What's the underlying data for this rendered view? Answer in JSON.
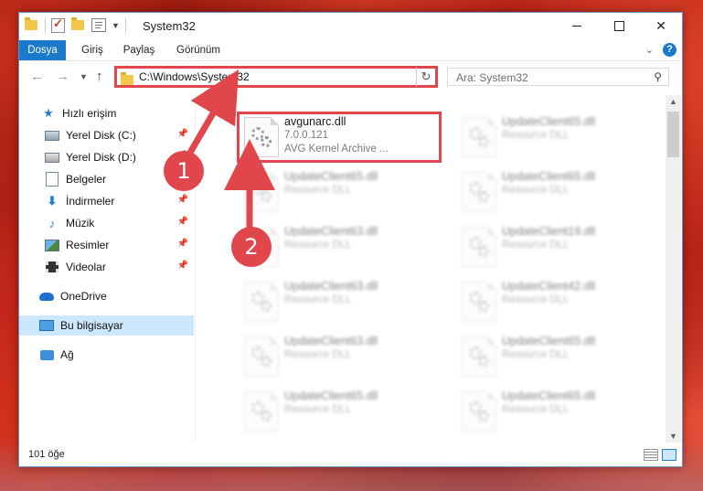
{
  "window": {
    "title": "System32"
  },
  "ribbon": {
    "tabs": [
      "Dosya",
      "Giriş",
      "Paylaş",
      "Görünüm"
    ]
  },
  "address": {
    "path": "C:\\Windows\\System32"
  },
  "search": {
    "placeholder": "Ara: System32"
  },
  "sidebar": {
    "items": [
      {
        "label": "Hızlı erişim",
        "icon": "star-icon"
      },
      {
        "label": "Yerel Disk (C:)",
        "icon": "drive-icon",
        "pinned": true
      },
      {
        "label": "Yerel Disk (D:)",
        "icon": "drive-icon",
        "pinned": true
      },
      {
        "label": "Belgeler",
        "icon": "documents-icon",
        "pinned": true
      },
      {
        "label": "İndirmeler",
        "icon": "download-icon",
        "pinned": true
      },
      {
        "label": "Müzik",
        "icon": "music-icon",
        "pinned": true
      },
      {
        "label": "Resimler",
        "icon": "pictures-icon",
        "pinned": true
      },
      {
        "label": "Videolar",
        "icon": "videos-icon",
        "pinned": true
      },
      {
        "label": "OneDrive",
        "icon": "onedrive-icon"
      },
      {
        "label": "Bu bilgisayar",
        "icon": "computer-icon",
        "selected": true
      },
      {
        "label": "Ağ",
        "icon": "network-icon"
      }
    ]
  },
  "files": {
    "highlighted": {
      "name": "avgunarc.dll",
      "version": "7.0.0.121",
      "desc": "AVG Kernel Archive ..."
    },
    "col1": [
      {
        "name": "UpdateClient65.dll",
        "desc": "Resource DLL"
      },
      {
        "name": "UpdateClient63.dll",
        "desc": "Resource DLL"
      },
      {
        "name": "UpdateClient63.dll",
        "desc": "Resource DLL"
      },
      {
        "name": "UpdateClient63.dll",
        "desc": "Resource DLL"
      },
      {
        "name": "UpdateClient65.dll",
        "desc": "Resource DLL"
      }
    ],
    "col2": [
      {
        "name": "UpdateClient65.dll",
        "desc": "Resource DLL"
      },
      {
        "name": "UpdateClient65.dll",
        "desc": "Resource DLL"
      },
      {
        "name": "UpdateClient19.dll",
        "desc": "Resource DLL"
      },
      {
        "name": "UpdateClient42.dll",
        "desc": "Resource DLL"
      },
      {
        "name": "UpdateClient65.dll",
        "desc": "Resource DLL"
      },
      {
        "name": "UpdateClient65.dll",
        "desc": "Resource DLL"
      }
    ]
  },
  "status": {
    "count": "101 öğe"
  },
  "callouts": {
    "one": "1",
    "two": "2"
  },
  "colors": {
    "accent": "#1979ca",
    "callout": "#e0464c",
    "selected": "#cce8ff"
  }
}
